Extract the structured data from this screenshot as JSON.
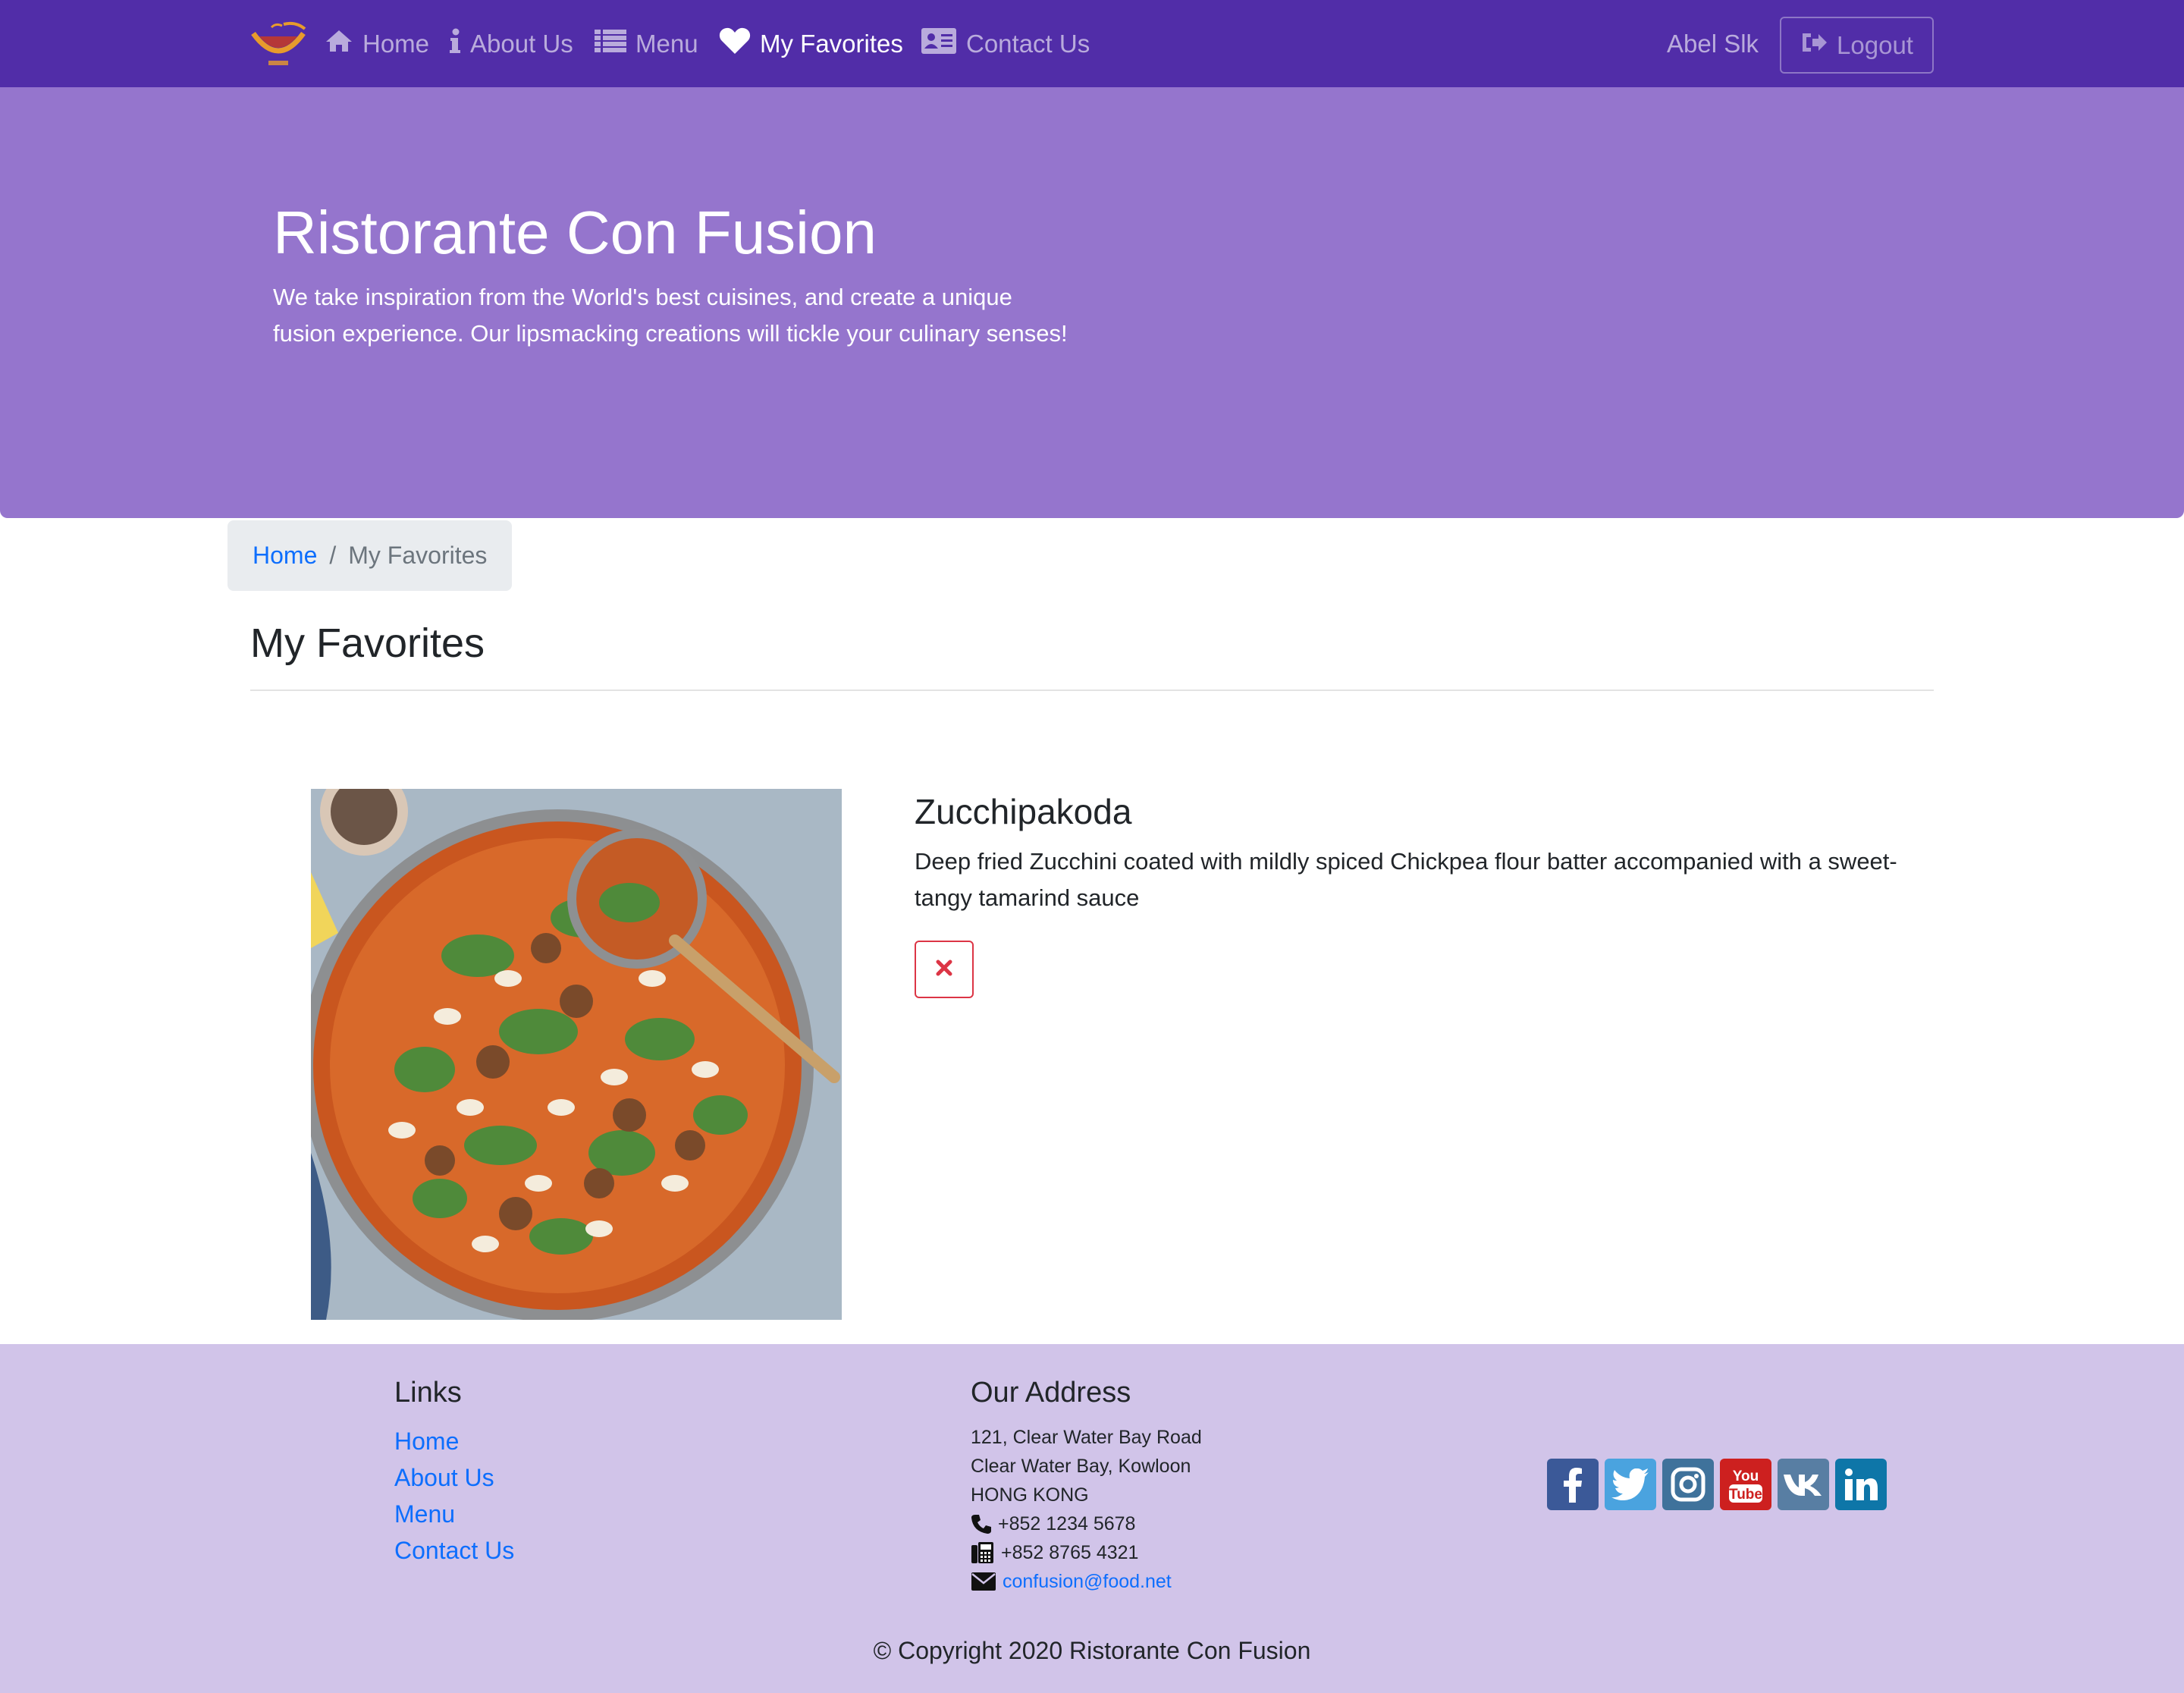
{
  "navbar": {
    "items": [
      {
        "label": "Home",
        "icon": "home-icon"
      },
      {
        "label": "About Us",
        "icon": "info-icon"
      },
      {
        "label": "Menu",
        "icon": "list-icon"
      },
      {
        "label": "My Favorites",
        "icon": "heart-icon",
        "active": true
      },
      {
        "label": "Contact Us",
        "icon": "address-card-icon"
      }
    ],
    "user_name": "Abel Slk",
    "logout_label": "Logout",
    "brand_color": "#512DA8"
  },
  "jumbotron": {
    "title": "Ristorante Con Fusion",
    "text": "We take inspiration from the World's best cuisines, and create a unique fusion experience. Our lipsmacking creations will tickle your culinary senses!",
    "color": "#9575CD"
  },
  "breadcrumb": {
    "home": "Home",
    "separator": "/",
    "current": "My Favorites"
  },
  "page_title": "My Favorites",
  "favorites": [
    {
      "name": "Zucchipakoda",
      "description": "Deep fried Zucchini coated with mildly spiced Chickpea flour batter accompanied with a sweet-tangy tamarind sauce",
      "delete_icon": "times-icon"
    }
  ],
  "footer": {
    "links_heading": "Links",
    "links": [
      "Home",
      "About Us",
      "Menu",
      "Contact Us"
    ],
    "address_heading": "Our Address",
    "address": [
      "121, Clear Water Bay Road",
      "Clear Water Bay, Kowloon",
      "HONG KONG"
    ],
    "phone": "+852 1234 5678",
    "fax": "+852 8765 4321",
    "email": "confusion@food.net",
    "social": [
      "facebook-icon",
      "twitter-icon",
      "instagram-icon",
      "youtube-icon",
      "vk-icon",
      "linkedin-icon"
    ],
    "copyright": "© Copyright 2020 Ristorante Con Fusion",
    "color": "#D1C4E9"
  }
}
